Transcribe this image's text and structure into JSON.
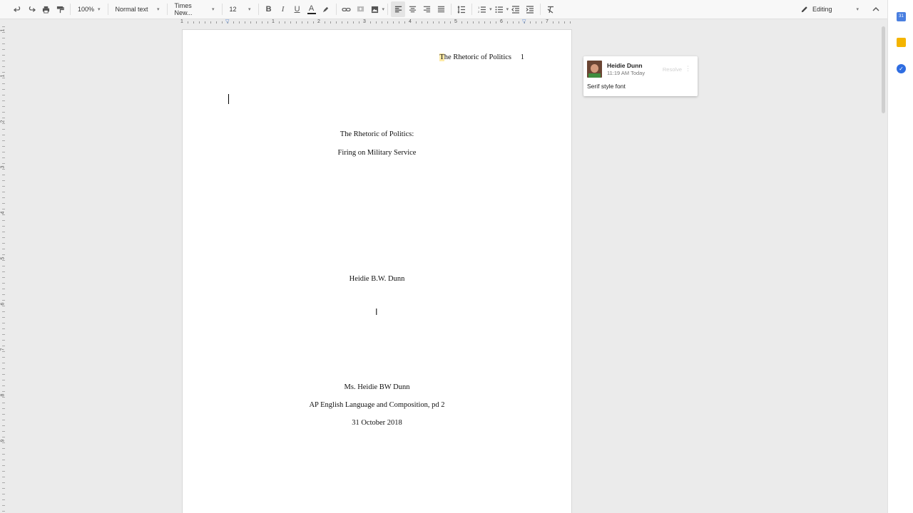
{
  "toolbar": {
    "zoom": "100%",
    "style": "Normal text",
    "font": "Times New...",
    "font_size": "12",
    "mode": "Editing"
  },
  "ruler": {
    "numbers": [
      "1",
      "1",
      "2",
      "3",
      "4",
      "5",
      "6",
      "7"
    ]
  },
  "vruler": {
    "numbers": [
      "1",
      "1",
      "2",
      "3",
      "4",
      "5",
      "6",
      "7",
      "8",
      "9"
    ]
  },
  "document": {
    "header_highlight": "T",
    "header_rest": "he Rhetoric of Politics",
    "page_number": "1",
    "title_line1": "The Rhetoric of Politics:",
    "title_line2": "Firing on Military Service",
    "author": "Heidie B.W. Dunn",
    "teacher": "Ms. Heidie BW Dunn",
    "course": "AP English Language and Composition, pd 2",
    "date": "31 October 2018"
  },
  "comment": {
    "author": "Heidie Dunn",
    "time": "11:19 AM Today",
    "resolve_label": "Resolve",
    "text": "Serif style font"
  },
  "colors": {
    "accent": "#4a7fd6",
    "highlight": "#fdeaa6",
    "keep": "#f4b400"
  }
}
